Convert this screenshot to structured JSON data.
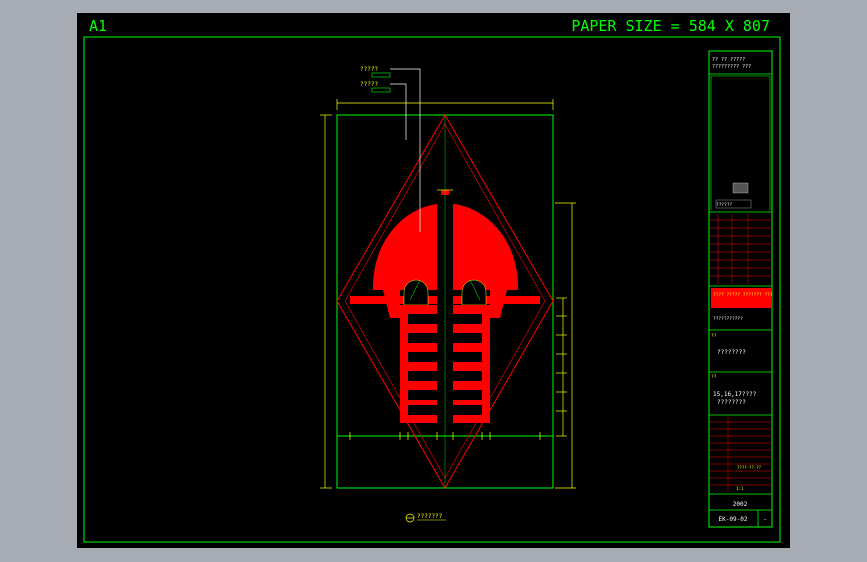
{
  "sheet": {
    "size_code": "A1",
    "paper_size": "PAPER SIZE = 584 X 807"
  },
  "callouts": {
    "label_top": "?????",
    "label_bottom": "?????",
    "bottom_note": "???????"
  },
  "title_block": {
    "header_lines": [
      "?? ?? ?????",
      "????????? ???"
    ],
    "stamp_line": "??????",
    "company_name": "???? ????? ??????? ???",
    "company_sub": "???????????",
    "project_label": "??",
    "project_value": "????????",
    "drawing_label": "??",
    "drawing_line1": "15,16,17????",
    "drawing_line2": "????????",
    "scale": "????",
    "date_value": "????-??-??",
    "ratio_value": "1:1",
    "year": "2002",
    "drawing_no": "EK-09-02",
    "sheet_mark": "-"
  },
  "colors": {
    "frame": "#00ff00",
    "figure": "#ff0000",
    "dimension": "#ffff00",
    "background": "#000000",
    "window": "#a6abb4"
  }
}
